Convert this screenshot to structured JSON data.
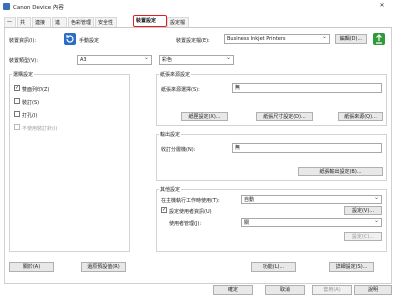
{
  "window": {
    "title": "Canon Device 內容",
    "close": "✕",
    "minimize": "—"
  },
  "tabs": [
    "一般",
    "共用",
    "連接埠",
    "進階",
    "色彩管理",
    "安全性",
    "裝置設定",
    "設定檔"
  ],
  "active_tab": "裝置設定",
  "top": {
    "device_code_label": "裝置資訊(I):",
    "manual_set": "手動設定",
    "config_label": "裝置設定檔(E):",
    "profile_name": "Business Inkjet Printers",
    "edit_button": "編輯(D)...",
    "device_type_label": "裝置類型(V):",
    "device_type_value": "A3",
    "color_value": "彩色"
  },
  "left_group": {
    "title": "選購設定",
    "items": [
      {
        "label": "雙面列印(Z)",
        "checked": true,
        "disabled": false
      },
      {
        "label": "裝訂(S)",
        "checked": false,
        "disabled": false
      },
      {
        "label": "打孔(I)",
        "checked": false,
        "disabled": false
      },
      {
        "label": "不使用裝訂針(I)",
        "checked": false,
        "disabled": true
      }
    ]
  },
  "paper_source": {
    "title": "紙張來源設定",
    "label": "紙張來源選擇(S):",
    "value": "無",
    "buttons": [
      "紙匣設定(X)...",
      "紙張尺寸設定(D)...",
      "紙張來源(Q)..."
    ]
  },
  "output": {
    "title": "輸出設定",
    "label": "收訂分層機(N):",
    "value": "無",
    "button": "紙張輸出設定(B)..."
  },
  "other": {
    "title": "其他設定",
    "auto_label": "在主機執行工作時使用(T):",
    "auto_value": "自動",
    "user_check_label": "設定使用者資訊(U)",
    "user_check_checked": true,
    "settings_button": "設定(V)...",
    "user_mgmt_label": "使用者管理(J):",
    "user_mgmt_value": "關",
    "disabled_button": "設定(C)..."
  },
  "bottom_row": {
    "about": "關於(A)",
    "restore": "還原預設值(R)",
    "functions": "功能(L)...",
    "advanced": "詳細設定(S)..."
  },
  "footer": {
    "ok": "確定",
    "cancel": "取消",
    "apply": "套用(A)",
    "help": "說明"
  },
  "colors": {
    "accent": "#e02020",
    "icon_blue": "#2b6cc4",
    "icon_green": "#2f9a3a"
  }
}
